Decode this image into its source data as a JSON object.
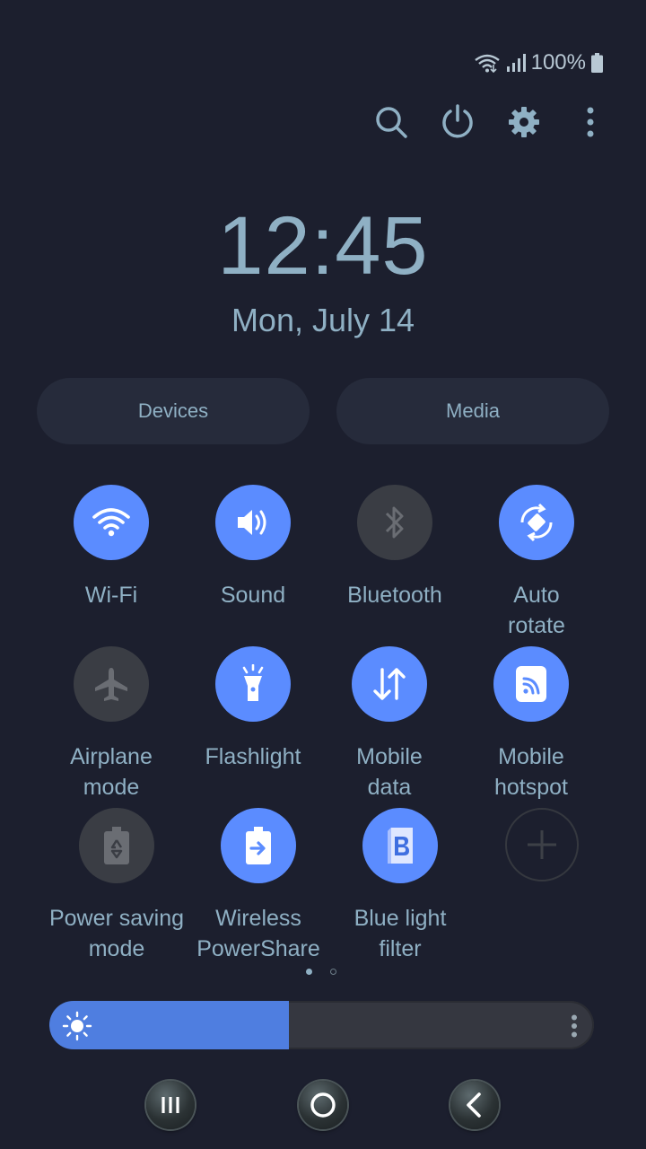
{
  "status_bar": {
    "battery_text": "100%",
    "icons": [
      "wifi-icon",
      "signal-icon",
      "battery-icon"
    ]
  },
  "top_actions": [
    "search-icon",
    "power-icon",
    "settings-icon",
    "more-vert-icon"
  ],
  "clock": {
    "time": "12:45",
    "date": "Mon, July 14"
  },
  "buttons": {
    "devices": "Devices",
    "media": "Media"
  },
  "tiles": [
    {
      "label": "Wi-Fi",
      "state": "on",
      "icon": "wifi-icon"
    },
    {
      "label": "Sound",
      "state": "on",
      "icon": "volume-icon"
    },
    {
      "label": "Bluetooth",
      "state": "off",
      "icon": "bluetooth-icon"
    },
    {
      "label": "Auto\nrotate",
      "state": "on",
      "icon": "auto-rotate-icon"
    },
    {
      "label": "Airplane\nmode",
      "state": "off",
      "icon": "airplane-icon"
    },
    {
      "label": "Flashlight",
      "state": "on",
      "icon": "flashlight-icon"
    },
    {
      "label": "Mobile\ndata",
      "state": "on",
      "icon": "mobile-data-icon"
    },
    {
      "label": "Mobile\nhotspot",
      "state": "on",
      "icon": "hotspot-icon"
    },
    {
      "label": "Power saving\nmode",
      "state": "off",
      "icon": "power-saving-icon"
    },
    {
      "label": "Wireless\nPowerShare",
      "state": "on",
      "icon": "wireless-powershare-icon"
    },
    {
      "label": "Blue light\nfilter",
      "state": "on",
      "icon": "blue-light-filter-icon"
    },
    {
      "label": "",
      "state": "add",
      "icon": "add-icon"
    }
  ],
  "pagination": {
    "pages": 2,
    "current": 1
  },
  "brightness": {
    "level": 0.44
  },
  "nav_bar": [
    "recents-icon",
    "home-icon",
    "back-icon"
  ],
  "colors": {
    "background": "#1c1f2e",
    "accent": "#5b8cff",
    "text": "#8fb0c4",
    "off_tile": "#3a3d44"
  }
}
